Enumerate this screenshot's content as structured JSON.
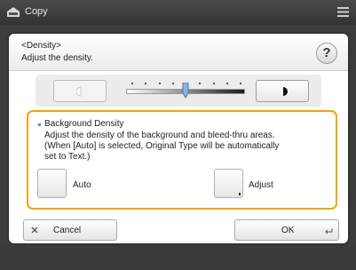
{
  "window": {
    "title": "Copy",
    "app_icon": "copy-icon",
    "menu_icon": "menu-icon"
  },
  "dialog": {
    "title_line1": "<Density>",
    "title_line2": "Adjust the density.",
    "help_label": "?"
  },
  "density": {
    "lighter_icon": "lighter-icon",
    "darker_icon": "darker-icon",
    "level_fraction": 0.5
  },
  "background_density": {
    "heading": "Background Density",
    "description_lines": [
      "Adjust the density of the background and bleed-thru areas.",
      "(When [Auto] is selected, Original Type will be automatically",
      "set to Text.)"
    ],
    "options": [
      {
        "label": "Auto"
      },
      {
        "label": "Adjust"
      }
    ]
  },
  "footer": {
    "cancel_label": "Cancel",
    "ok_label": "OK"
  },
  "colors": {
    "accent_border": "#f0a500",
    "bullet": "#4a8fd8"
  }
}
